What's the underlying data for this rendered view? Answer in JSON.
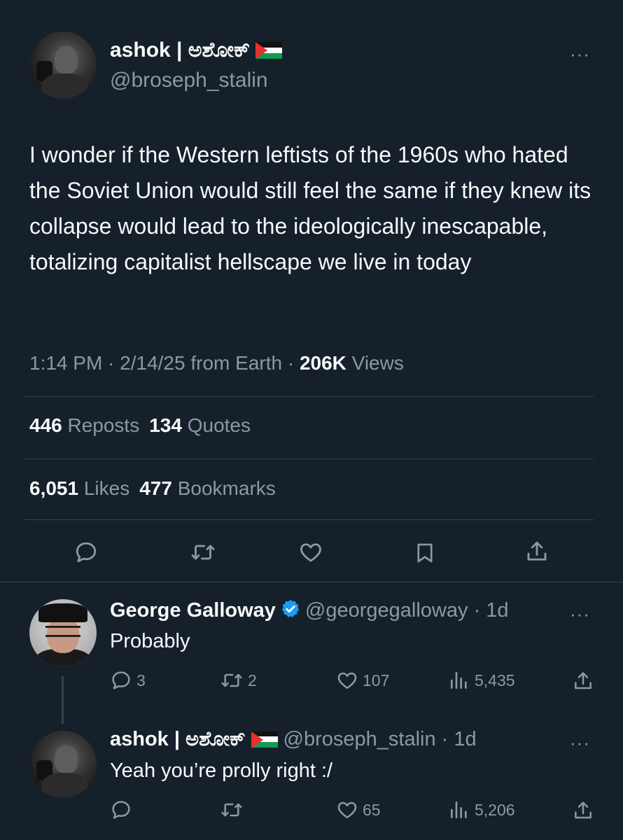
{
  "main_tweet": {
    "display_name": "ashok | ಅಶೋಕ್",
    "handle": "@broseph_stalin",
    "text": "I wonder if the Western leftists of the 1960s who hated the Soviet Union would still feel the same if they knew its collapse would lead to the ideologically inescapable, totalizing capitalist hellscape we live in today",
    "meta_prefix": "1:14 PM · 2/14/25 from Earth · ",
    "views_count": "206K",
    "views_label": " Views",
    "reposts_count": "446",
    "reposts_label": " Reposts",
    "quotes_count": "134",
    "quotes_label": " Quotes",
    "likes_count": "6,051",
    "likes_label": " Likes",
    "bookmarks_count": "477",
    "bookmarks_label": " Bookmarks",
    "more_label": "···"
  },
  "replies": [
    {
      "display_name": "George Galloway",
      "handle_time": "@georgegalloway · 1d",
      "text": "Probably",
      "reply_count": "3",
      "repost_count": "2",
      "like_count": "107",
      "view_count": "5,435",
      "more_label": "···"
    },
    {
      "display_name": "ashok | ಅಶೋಕ್",
      "handle_time": "@broseph_stalin · 1d",
      "text": "Yeah you’re prolly right :/",
      "reply_count": "",
      "repost_count": "",
      "like_count": "65",
      "view_count": "5,206",
      "more_label": "···"
    }
  ],
  "icons": {
    "reply": "reply-icon",
    "repost": "repost-icon",
    "like": "heart-icon",
    "bookmark": "bookmark-icon",
    "share": "share-icon",
    "views": "views-icon",
    "verified": "verified-badge-icon",
    "flag": "palestine-flag-icon"
  },
  "colors": {
    "background": "#15202b",
    "text": "#f7f9f9",
    "muted": "#8b98a5",
    "divider": "#38444d",
    "verified": "#1d9bf0"
  }
}
